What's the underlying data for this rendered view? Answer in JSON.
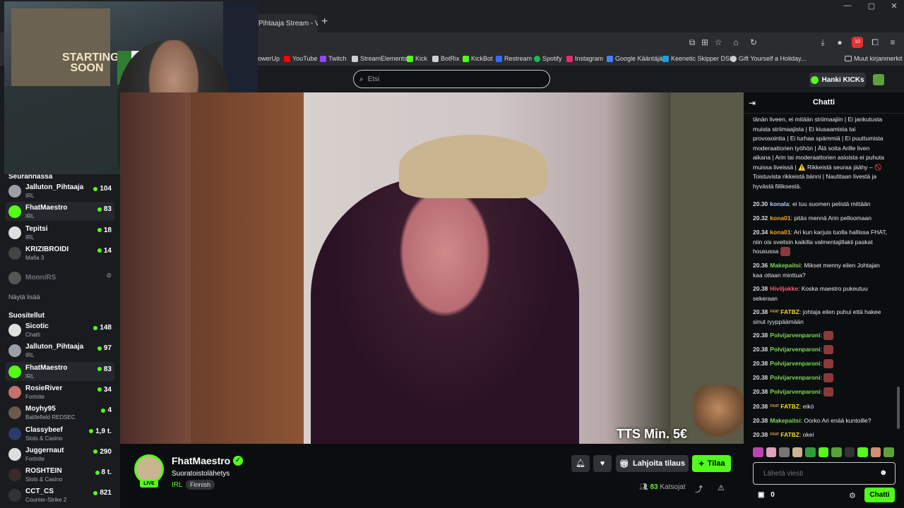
{
  "browser": {
    "tab_title": "Pihtaaja Stream - V",
    "tab_close": "✕",
    "new_tab": "+",
    "window_controls": [
      "—",
      "▢",
      "✕"
    ],
    "bookmarks": [
      {
        "label": "owerUp",
        "color": "#888"
      },
      {
        "label": "YouTube",
        "color": "#ff0000"
      },
      {
        "label": "Twitch",
        "color": "#9146ff"
      },
      {
        "label": "StreamElements",
        "color": "#cfcfcf"
      },
      {
        "label": "Kick",
        "color": "#53fc18"
      },
      {
        "label": "BotRix",
        "color": "#cfcfcf"
      },
      {
        "label": "KickBot",
        "color": "#53fc18"
      },
      {
        "label": "Restream",
        "color": "#2f6bff"
      },
      {
        "label": "Spotify",
        "color": "#1db954"
      },
      {
        "label": "Instagram",
        "color": "#e1306c"
      },
      {
        "label": "Google Kääntäjä",
        "color": "#4285f4"
      },
      {
        "label": "Keenetic Skipper DSL",
        "color": "#1aa0e0"
      },
      {
        "label": "Gift Yourself a Holiday...",
        "color": "#cfcfcf"
      },
      {
        "label": "Muut kirjanmerkit",
        "color": "#cfcfcf"
      }
    ],
    "downloads_badge": "10"
  },
  "header": {
    "search_placeholder": "Etsi",
    "kicks_button": "Hanki KICKs"
  },
  "sidebar": {
    "following_title": "Seurannassa",
    "following": [
      {
        "name": "Jalluton_Pihtaaja",
        "category": "IRL",
        "viewers": "104",
        "avatar": "#9aa0a6",
        "selected": false
      },
      {
        "name": "FhatMaestro",
        "category": "IRL",
        "viewers": "83",
        "avatar": "#53fc18",
        "selected": true
      },
      {
        "name": "Tepitsi",
        "category": "IRL",
        "viewers": "18",
        "avatar": "#e0e0e0",
        "selected": false
      },
      {
        "name": "KRIZIBROIDI",
        "category": "Mafia 3",
        "viewers": "14",
        "avatar": "#444",
        "selected": false
      }
    ],
    "offline_name": "MonniRS",
    "show_more": "Näytä lisää",
    "recommended_title": "Suositellut",
    "recommended": [
      {
        "name": "Sicotic",
        "category": "Chatti",
        "viewers": "148",
        "avatar": "#e0e0e0",
        "selected": false
      },
      {
        "name": "Jalluton_Pihtaaja",
        "category": "IRL",
        "viewers": "97",
        "avatar": "#9aa0a6",
        "selected": false
      },
      {
        "name": "FhatMaestro",
        "category": "IRL",
        "viewers": "83",
        "avatar": "#53fc18",
        "selected": true
      },
      {
        "name": "RosieRiver",
        "category": "Fortnite",
        "viewers": "34",
        "avatar": "#c2726b",
        "selected": false
      },
      {
        "name": "Moyhy95",
        "category": "Battlefield REDSEC",
        "viewers": "4",
        "avatar": "#6a5a4a",
        "selected": false
      },
      {
        "name": "Classybeef",
        "category": "Slots & Casino",
        "viewers": "1,9 t.",
        "avatar": "#2a3a6a",
        "selected": false
      },
      {
        "name": "Juggernaut",
        "category": "Fortnite",
        "viewers": "290",
        "avatar": "#ddd",
        "selected": false
      },
      {
        "name": "ROSHTEIN",
        "category": "Slots & Casino",
        "viewers": "8 t.",
        "avatar": "#3a2a2a",
        "selected": false
      },
      {
        "name": "CCT_CS",
        "category": "Counter-Strike 2",
        "viewers": "821",
        "avatar": "#333",
        "selected": false
      }
    ]
  },
  "webcam": {
    "poster_text": "STARTING SOON"
  },
  "video": {
    "tts_text": "TTS Min. 5€"
  },
  "stream": {
    "streamer": "FhatMaestro",
    "live_badge": "LIVE",
    "title": "Suoratoistolähetys",
    "category": "IRL",
    "language": "Finnish",
    "gift_button": "Lahjoita tilaus",
    "subscribe_button": "Tilaa",
    "viewer_count": "83",
    "viewer_label": "Katsojat"
  },
  "chat": {
    "title": "Chatti",
    "rules_text": "tänän liveen, ei mitään striimaajiin | Ei jankutusta muista striimaajista | Ei kiusaamista tai provosointia | Ei turhaa spämmiä | Ei puuttumista moderaattorien työhön | Älä soita Arille liven aikana | Arin tai moderaattorien asioista ei puhuta muissa liveissä | ⚠️ Rikkeistä seuraa jäähy – 🚫 Toistuvista rikkeistä bänni | Nautitaan livestä ja hyvästä fiiliksestä.",
    "messages": [
      {
        "time": "20.30",
        "user": "konala",
        "color": "#b7c6ff",
        "badge": "",
        "text": "ei tuu suomen pelistä mittään",
        "emote": false
      },
      {
        "time": "20.32",
        "user": "kona01",
        "color": "#f5a623",
        "badge": "",
        "text": "pitäs mennä Arin pelloomaan",
        "emote": false
      },
      {
        "time": "20.34",
        "user": "kona01",
        "color": "#f5a623",
        "badge": "",
        "text": "Ari kun karjuis tuolla hallissa FHAT, niin ois sveitsin kaikilla valmentajillakii paskat housussa",
        "emote": true
      },
      {
        "time": "20.36",
        "user": "Makepaitsi",
        "color": "#7ed957",
        "badge": "",
        "text": "Mikset menny eilen Johtajan kaa ottaan minttua?",
        "emote": false
      },
      {
        "time": "20.38",
        "user": "Hiviljokke",
        "color": "#ff5a6b",
        "badge": "",
        "text": "Koska maestro pukeutuu sekeraan",
        "emote": false
      },
      {
        "time": "20.38",
        "user": "FATBZ",
        "color": "#f5d623",
        "badge": "FRAT",
        "text": "johtaja eilen puhui että hakee sinut ryyppäämään",
        "emote": false
      },
      {
        "time": "20.38",
        "user": "Polvijarvenparoni",
        "color": "#7ed957",
        "badge": "",
        "text": "",
        "emote": true
      },
      {
        "time": "20.38",
        "user": "Polvijarvenparoni",
        "color": "#7ed957",
        "badge": "",
        "text": "",
        "emote": true
      },
      {
        "time": "20.38",
        "user": "Polvijarvenparoni",
        "color": "#7ed957",
        "badge": "",
        "text": "",
        "emote": true
      },
      {
        "time": "20.38",
        "user": "Polvijarvenparoni",
        "color": "#7ed957",
        "badge": "",
        "text": "",
        "emote": true
      },
      {
        "time": "20.38",
        "user": "Polvijarvenparoni",
        "color": "#7ed957",
        "badge": "",
        "text": "",
        "emote": true
      },
      {
        "time": "20.38",
        "user": "FATBZ",
        "color": "#f5d623",
        "badge": "FRAT",
        "text": "eikö",
        "emote": false
      },
      {
        "time": "20.38",
        "user": "Makepaitsi",
        "color": "#7ed957",
        "badge": "",
        "text": "Oorko Ari enää kuntoille?",
        "emote": false
      },
      {
        "time": "20.38",
        "user": "FATBZ",
        "color": "#f5d623",
        "badge": "FRAT",
        "text": "okei",
        "emote": false
      }
    ],
    "emote_colors": [
      "#c13fb5",
      "#e0a0c0",
      "#777",
      "#c9b58f",
      "#2f9e3a",
      "#53fc18",
      "#5aa339",
      "#333",
      "#53fc18",
      "#cf8f6f",
      "#5aa339"
    ],
    "input_placeholder": "Lähetä viesti",
    "points": "0",
    "send_button": "Chatti"
  }
}
